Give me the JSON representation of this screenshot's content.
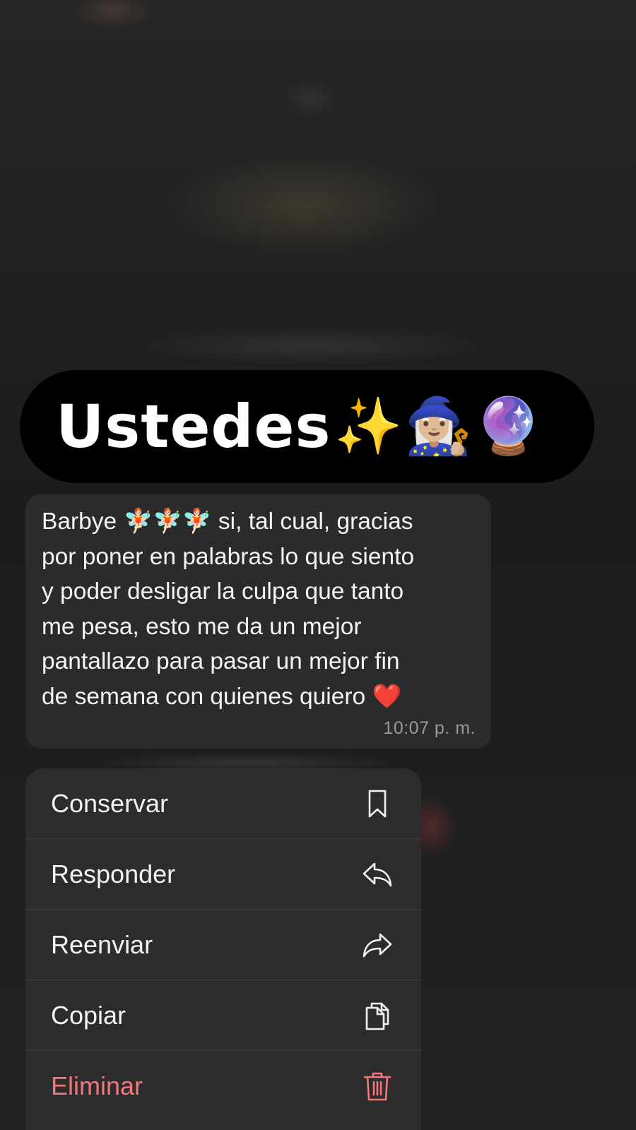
{
  "reaction": {
    "text": "Ustedes",
    "emojis": "✨🧙🏼‍♀️🔮"
  },
  "message": {
    "text": "Barbye 🧚🏻🧚🏻🧚🏻 si, tal cual, gracias\npor poner en palabras lo que siento\ny poder desligar la culpa que tanto\nme pesa, esto me da un mejor\npantallazo para pasar un mejor fin\nde semana con quienes quiero ❤️",
    "time": "10:07 p. m."
  },
  "menu": {
    "items": [
      {
        "label": "Conservar",
        "icon": "bookmark-icon"
      },
      {
        "label": "Responder",
        "icon": "reply-icon"
      },
      {
        "label": "Reenviar",
        "icon": "forward-icon"
      },
      {
        "label": "Copiar",
        "icon": "copy-icon"
      },
      {
        "label": "Eliminar",
        "icon": "trash-icon"
      }
    ],
    "danger_color": "#f3767b"
  }
}
